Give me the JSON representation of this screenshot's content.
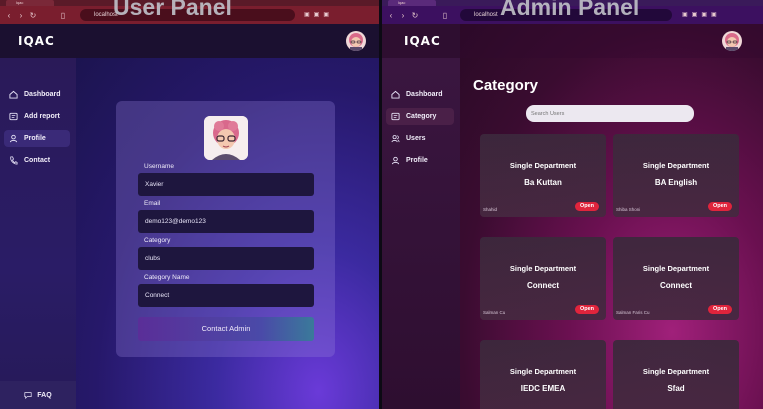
{
  "overlays": {
    "user_panel": "User Panel",
    "admin_panel": "Admin Panel"
  },
  "browser_left": {
    "tab": "lqac",
    "url": "localhost"
  },
  "browser_right": {
    "tab": "lqac",
    "url": "localhost"
  },
  "brand": {
    "logo": "IQAC"
  },
  "user": {
    "sidebar": [
      {
        "label": "Dashboard",
        "icon": "home-icon"
      },
      {
        "label": "Add report",
        "icon": "report-icon"
      },
      {
        "label": "Profile",
        "icon": "user-icon",
        "active": true
      },
      {
        "label": "Contact",
        "icon": "phone-icon"
      }
    ],
    "faq": "FAQ",
    "form": {
      "username_label": "Username",
      "username_value": "Xavier",
      "email_label": "Email",
      "email_value": "demo123@demo123",
      "category_label": "Category",
      "category_value": "clubs",
      "category_name_label": "Category Name",
      "category_name_value": "Connect",
      "submit": "Contact Admin"
    }
  },
  "admin": {
    "sidebar": [
      {
        "label": "Dashboard",
        "icon": "home-icon"
      },
      {
        "label": "Category",
        "icon": "category-icon",
        "active": true
      },
      {
        "label": "Users",
        "icon": "users-icon"
      },
      {
        "label": "Profile",
        "icon": "user-icon"
      }
    ],
    "title": "Category",
    "search_placeholder": "Search Users",
    "cards": [
      {
        "type": "Single Department",
        "name": "Ba Kuttan",
        "owner": "Shahid",
        "badge": "Open"
      },
      {
        "type": "Single Department",
        "name": "BA English",
        "owner": "Shiba Shoni",
        "badge": "Open"
      },
      {
        "type": "Single Department",
        "name": "Connect",
        "owner": "Salman Cu",
        "badge": "Open"
      },
      {
        "type": "Single Department",
        "name": "Connect",
        "owner": "Salman Faris Cu",
        "badge": "Open"
      },
      {
        "type": "Single Department",
        "name": "IEDC EMEA",
        "owner": "",
        "badge": ""
      },
      {
        "type": "Single Department",
        "name": "Sfad",
        "owner": "",
        "badge": ""
      }
    ]
  },
  "colors": {
    "open_badge": "#e0243c",
    "user_accent": "#6a3ad8",
    "admin_accent": "#a0207a"
  }
}
